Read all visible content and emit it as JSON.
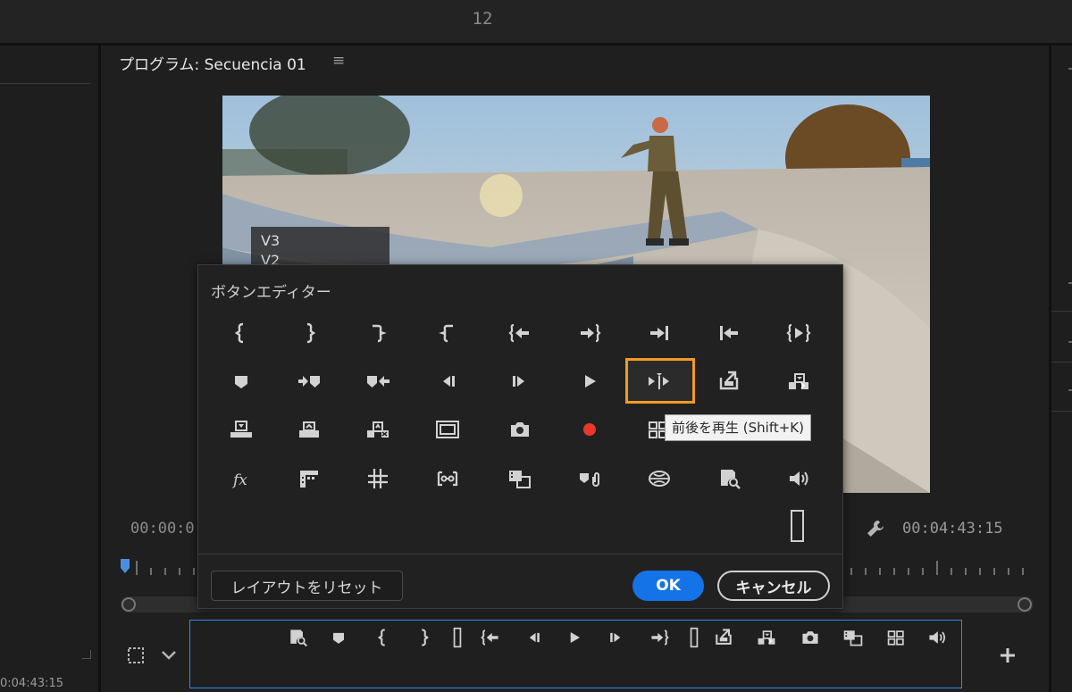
{
  "top_bar": {
    "number": "12"
  },
  "left_panel": {
    "timecode": "0:04:43:15"
  },
  "program_monitor": {
    "title": "プログラム: Secuencia 01",
    "menu_glyph": "≡",
    "tracks": [
      "V3",
      "V2"
    ],
    "timecode_left": "00:00:0",
    "timecode_right": "00:04:43:15"
  },
  "button_editor": {
    "title": "ボタンエディター",
    "rows": [
      [
        "mark-in",
        "mark-out",
        "clear-in",
        "clear-out",
        "go-to-in",
        "go-to-out",
        "go-to-next-edit",
        "go-to-previous-edit",
        "play-in-to-out"
      ],
      [
        "add-marker",
        "go-to-next-marker",
        "go-to-previous-marker",
        "step-back",
        "step-forward",
        "play-stop",
        "play-around",
        "lift",
        "extract"
      ],
      [
        "insert",
        "overwrite",
        "replace",
        "safe-margins",
        "export-frame",
        "record",
        "multi-camera",
        "",
        ""
      ],
      [
        "fx",
        "comparison-view",
        "proxy",
        "vr-video",
        "trim-monitor",
        "link",
        "global-fx-mute",
        "show-rulers",
        "volume"
      ]
    ],
    "highlighted_button": "play-around",
    "tooltip": "前後を再生 (Shift+K)",
    "reset_label": "レイアウトをリセット",
    "ok_label": "OK",
    "cancel_label": "キャンセル"
  },
  "transport_bar": {
    "buttons": [
      "show-rulers",
      "add-marker",
      "mark-in",
      "mark-out",
      "spacer",
      "go-to-in",
      "step-back",
      "play-stop",
      "step-forward",
      "go-to-out",
      "spacer",
      "lift",
      "extract",
      "export-frame",
      "trim-monitor",
      "multi-camera",
      "volume"
    ]
  },
  "colors": {
    "accent_blue": "#1473e6",
    "highlight_orange": "#f39a24",
    "record_red": "#e8382c"
  }
}
